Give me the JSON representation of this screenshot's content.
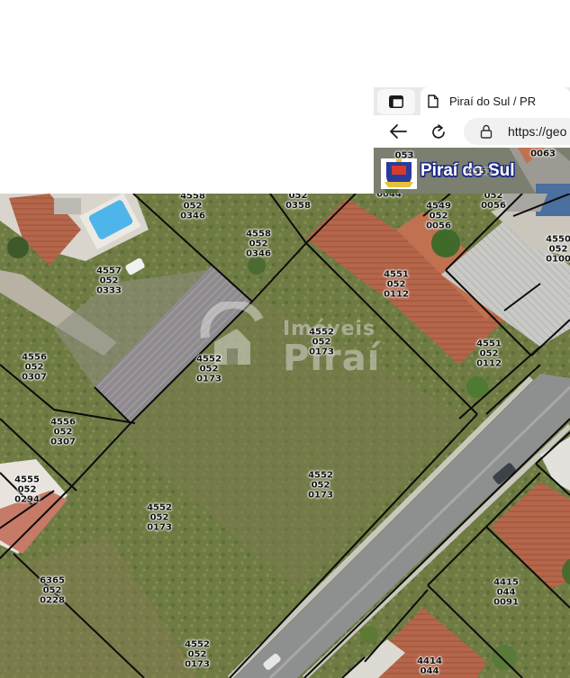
{
  "browser": {
    "tab_title": "Piraí do Sul / PR",
    "url": "https://geo",
    "icons": [
      "tab-actions-icon",
      "page-icon",
      "back-arrow-icon",
      "refresh-icon",
      "lock-icon"
    ]
  },
  "site": {
    "logo_text": "Piraí do Sul",
    "strip_labels": [
      {
        "text": "053",
        "name": "strip-label-053"
      },
      {
        "text": "0063",
        "name": "strip-label-0063"
      },
      {
        "text": "4551",
        "name": "strip-label-4551"
      }
    ]
  },
  "watermark": {
    "line1": "Imóveis",
    "line2": "Piraí"
  },
  "map": {
    "parcels": [
      {
        "id": "p1",
        "lines": [
          "4558",
          "052",
          "0346"
        ]
      },
      {
        "id": "p2",
        "lines": [
          "052",
          "0358"
        ]
      },
      {
        "id": "p3",
        "lines": [
          "0044"
        ]
      },
      {
        "id": "p4",
        "lines": [
          "4549",
          "052",
          "0056"
        ]
      },
      {
        "id": "p5",
        "lines": [
          "052",
          "0056"
        ]
      },
      {
        "id": "p6",
        "lines": [
          "4550",
          "052",
          "0100"
        ]
      },
      {
        "id": "p7",
        "lines": [
          "4558",
          "052",
          "0346"
        ]
      },
      {
        "id": "p8",
        "lines": [
          "4557",
          "052",
          "0333"
        ]
      },
      {
        "id": "p9",
        "lines": [
          "4551",
          "052",
          "0112"
        ]
      },
      {
        "id": "p10",
        "lines": [
          "4552",
          "052",
          "0173"
        ]
      },
      {
        "id": "p11",
        "lines": [
          "4551",
          "052",
          "0112"
        ]
      },
      {
        "id": "p12",
        "lines": [
          "4552",
          "052",
          "0173"
        ]
      },
      {
        "id": "p13",
        "lines": [
          "4556",
          "052",
          "0307"
        ]
      },
      {
        "id": "p14",
        "lines": [
          "4556",
          "052",
          "0307"
        ]
      },
      {
        "id": "p15",
        "lines": [
          "4552",
          "052",
          "0173"
        ]
      },
      {
        "id": "p16",
        "lines": [
          "4555",
          "052",
          "0294"
        ]
      },
      {
        "id": "p17",
        "lines": [
          "4552",
          "052",
          "0173"
        ]
      },
      {
        "id": "p18",
        "lines": [
          "4415",
          "044",
          "0091"
        ]
      },
      {
        "id": "p19",
        "lines": [
          "6365",
          "052",
          "0228"
        ]
      },
      {
        "id": "p20",
        "lines": [
          "4552",
          "052",
          "0173"
        ]
      },
      {
        "id": "p21",
        "lines": [
          "4414",
          "044"
        ]
      }
    ]
  }
}
